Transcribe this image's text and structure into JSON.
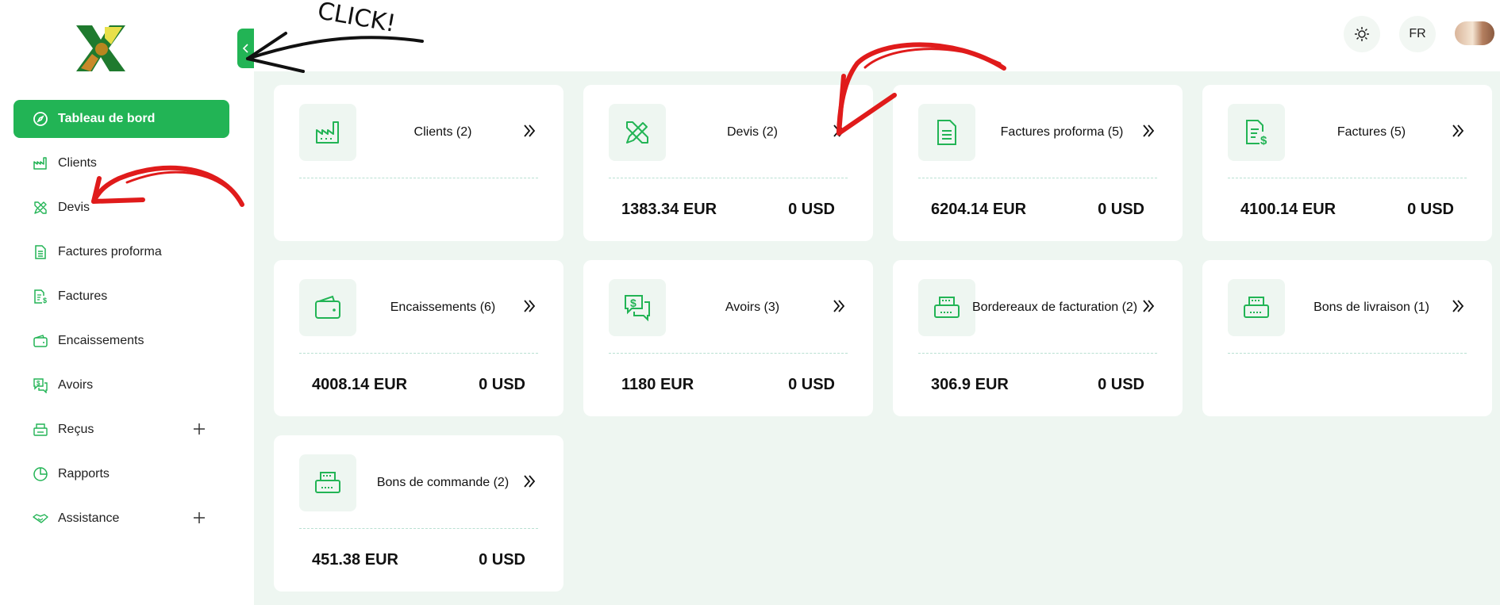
{
  "sidebar": {
    "items": [
      {
        "label": "Tableau de bord",
        "icon": "compass-icon",
        "active": true
      },
      {
        "label": "Clients",
        "icon": "factory-icon"
      },
      {
        "label": "Devis",
        "icon": "pencil-ruler-icon"
      },
      {
        "label": "Factures proforma",
        "icon": "document-icon"
      },
      {
        "label": "Factures",
        "icon": "invoice-dollar-icon"
      },
      {
        "label": "Encaissements",
        "icon": "wallet-icon"
      },
      {
        "label": "Avoirs",
        "icon": "dollar-chat-icon"
      },
      {
        "label": "Reçus",
        "icon": "printer-icon",
        "expandable": true
      },
      {
        "label": "Rapports",
        "icon": "pie-chart-icon"
      },
      {
        "label": "Assistance",
        "icon": "handshake-icon",
        "expandable": true
      }
    ]
  },
  "header": {
    "theme_icon": "sun-icon",
    "language": "FR"
  },
  "cards": [
    {
      "title": "Clients (2)",
      "icon": "factory-icon",
      "eur": "",
      "usd": ""
    },
    {
      "title": "Devis (2)",
      "icon": "pencil-ruler-icon",
      "eur": "1383.34 EUR",
      "usd": "0 USD"
    },
    {
      "title": "Factures proforma (5)",
      "icon": "document-icon",
      "eur": "6204.14 EUR",
      "usd": "0 USD"
    },
    {
      "title": "Factures (5)",
      "icon": "invoice-dollar-icon",
      "eur": "4100.14 EUR",
      "usd": "0 USD"
    },
    {
      "title": "Encaissements (6)",
      "icon": "wallet-icon",
      "eur": "4008.14 EUR",
      "usd": "0 USD"
    },
    {
      "title": "Avoirs (3)",
      "icon": "dollar-chat-icon",
      "eur": "1180 EUR",
      "usd": "0 USD"
    },
    {
      "title": "Bordereaux de facturation (2)",
      "icon": "printer-icon",
      "eur": "306.9 EUR",
      "usd": "0 USD"
    },
    {
      "title": "Bons de livraison (1)",
      "icon": "printer-icon",
      "eur": "",
      "usd": ""
    },
    {
      "title": "Bons de commande (2)",
      "icon": "printer-icon",
      "eur": "451.38 EUR",
      "usd": "0 USD"
    }
  ],
  "annotations": {
    "click_text": "CLICK!"
  },
  "colors": {
    "accent": "#22b455",
    "background": "#eef6f1",
    "annotation_red": "#e01b1b"
  }
}
